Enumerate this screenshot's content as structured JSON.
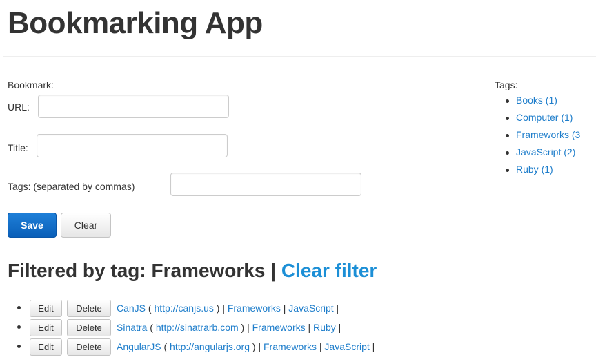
{
  "header": {
    "title": "Bookmarking App"
  },
  "form": {
    "heading": "Bookmark:",
    "url_label": "URL:",
    "url_value": "",
    "title_label": "Title:",
    "title_value": "",
    "tags_label": "Tags: (separated by commas)",
    "tags_value": "",
    "save_label": "Save",
    "clear_label": "Clear"
  },
  "tags_panel": {
    "title": "Tags:",
    "items": [
      {
        "label": "Books (1)"
      },
      {
        "label": "Computer (1)"
      },
      {
        "label": "Frameworks (3"
      },
      {
        "label": "JavaScript (2)"
      },
      {
        "label": "Ruby (1)"
      }
    ]
  },
  "filter": {
    "prefix": "Filtered by tag: Frameworks |",
    "clear_label": "Clear filter"
  },
  "bookmarks": [
    {
      "title": "CanJS",
      "url": "http://canjs.us",
      "tags": [
        "Frameworks",
        "JavaScript"
      ]
    },
    {
      "title": "Sinatra",
      "url": "http://sinatrarb.com",
      "tags": [
        "Frameworks",
        "Ruby"
      ]
    },
    {
      "title": "AngularJS",
      "url": "http://angularjs.org",
      "tags": [
        "Frameworks",
        "JavaScript"
      ]
    }
  ],
  "row_actions": {
    "edit_label": "Edit",
    "delete_label": "Delete"
  },
  "colors": {
    "link": "#1f7ecb",
    "primary": "#0a5fb8",
    "text": "#333333"
  }
}
